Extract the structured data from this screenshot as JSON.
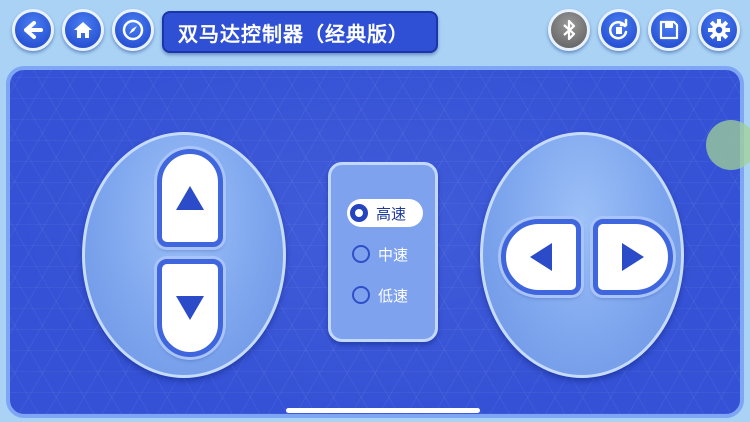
{
  "header": {
    "title": "双马达控制器（经典版）",
    "nav_buttons": [
      {
        "name": "back",
        "icon": "back-arrow-icon"
      },
      {
        "name": "home",
        "icon": "home-icon"
      },
      {
        "name": "compass",
        "icon": "compass-icon"
      }
    ],
    "action_buttons": [
      {
        "name": "bluetooth",
        "icon": "bluetooth-icon",
        "state": "disconnected"
      },
      {
        "name": "refresh",
        "icon": "refresh-icon"
      },
      {
        "name": "save",
        "icon": "save-icon"
      },
      {
        "name": "settings",
        "icon": "gear-icon"
      }
    ]
  },
  "controls": {
    "left_pad": {
      "buttons": [
        "up",
        "down"
      ]
    },
    "right_pad": {
      "buttons": [
        "left",
        "right"
      ]
    }
  },
  "speed": {
    "options": [
      {
        "label": "高速",
        "selected": true
      },
      {
        "label": "中速",
        "selected": false
      },
      {
        "label": "低速",
        "selected": false
      }
    ]
  },
  "colors": {
    "accent": "#2f50d4",
    "panel": "#3552d6",
    "pad": "#7ea6ee",
    "arrow": "#2b4bc8",
    "background": "#a9d2f5"
  }
}
